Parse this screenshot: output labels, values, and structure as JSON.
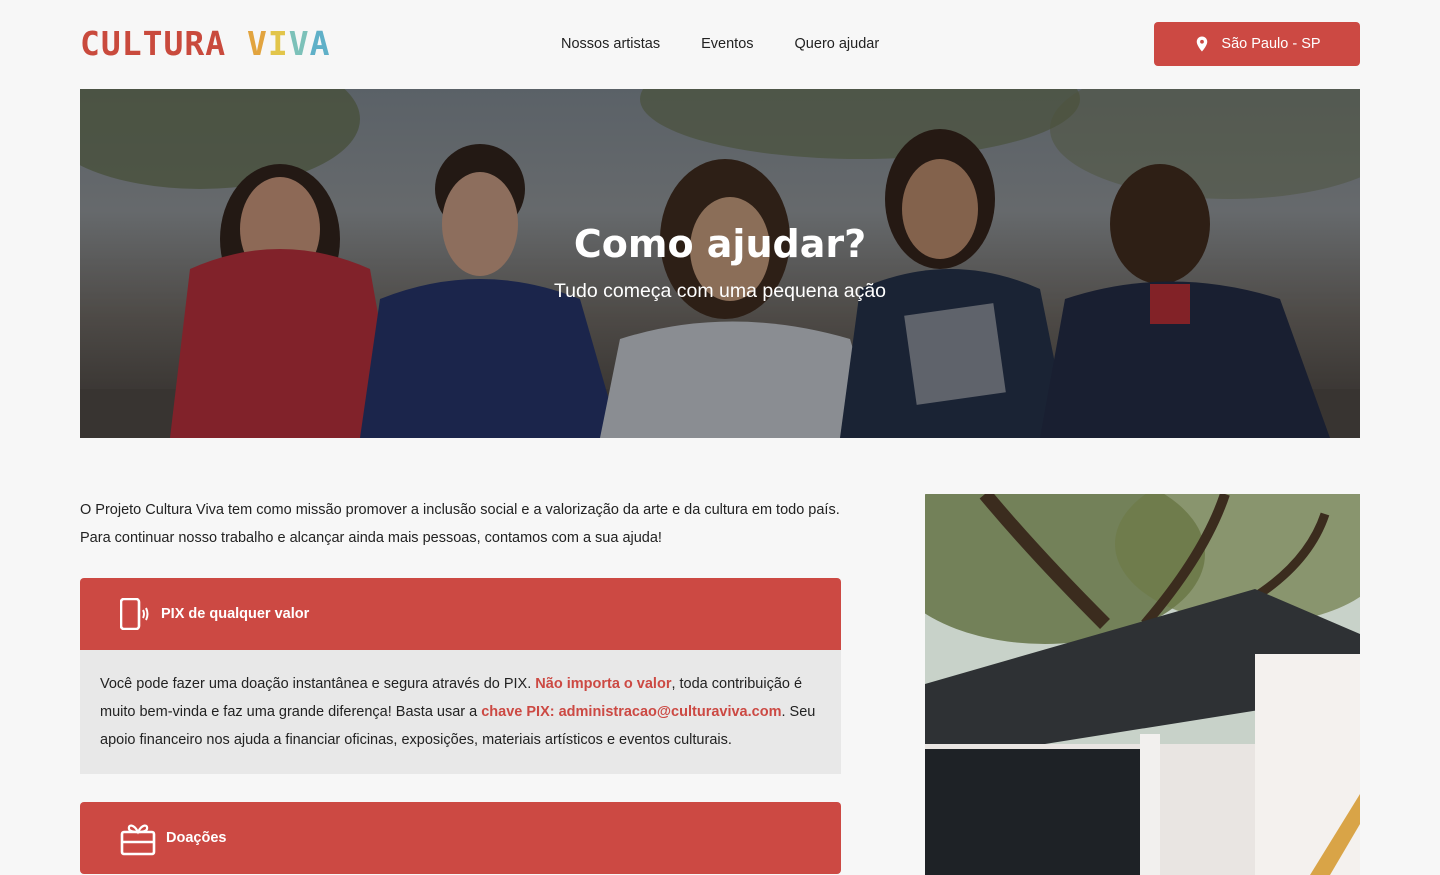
{
  "header": {
    "logo_text": "CULTURA VIVA",
    "nav": [
      {
        "label": "Nossos artistas"
      },
      {
        "label": "Eventos"
      },
      {
        "label": "Quero ajudar"
      }
    ],
    "location_button": {
      "label": "São Paulo - SP",
      "icon": "map-pin-icon"
    }
  },
  "hero": {
    "title": "Como ajudar?",
    "subtitle": "Tudo começa com uma pequena ação"
  },
  "intro": {
    "line1": "O Projeto Cultura Viva tem como missão promover a inclusão social e a valorização da arte e da cultura em todo país.",
    "line2": "Para continuar nosso trabalho e alcançar ainda mais pessoas, contamos com a sua ajuda!"
  },
  "accordion": [
    {
      "title": "PIX de qualquer valor",
      "icon": "smartphone-icon",
      "expanded": true,
      "body": {
        "part1": "Você pode fazer uma doação instantânea e segura através do PIX. ",
        "highlight1": "Não importa o valor",
        "part2": ", toda contribuição é muito bem-vinda e faz uma grande diferença! Basta usar a ",
        "highlight2": "chave PIX: administracao@culturaviva.com",
        "part3": ". Seu apoio financeiro nos ajuda a financiar oficinas, exposições, materiais artísticos e eventos culturais."
      }
    },
    {
      "title": "Doações",
      "icon": "gift-icon",
      "expanded": false
    }
  ],
  "colors": {
    "accent": "#cc4943",
    "background": "#f7f7f7",
    "panel": "#e8e8e8"
  }
}
